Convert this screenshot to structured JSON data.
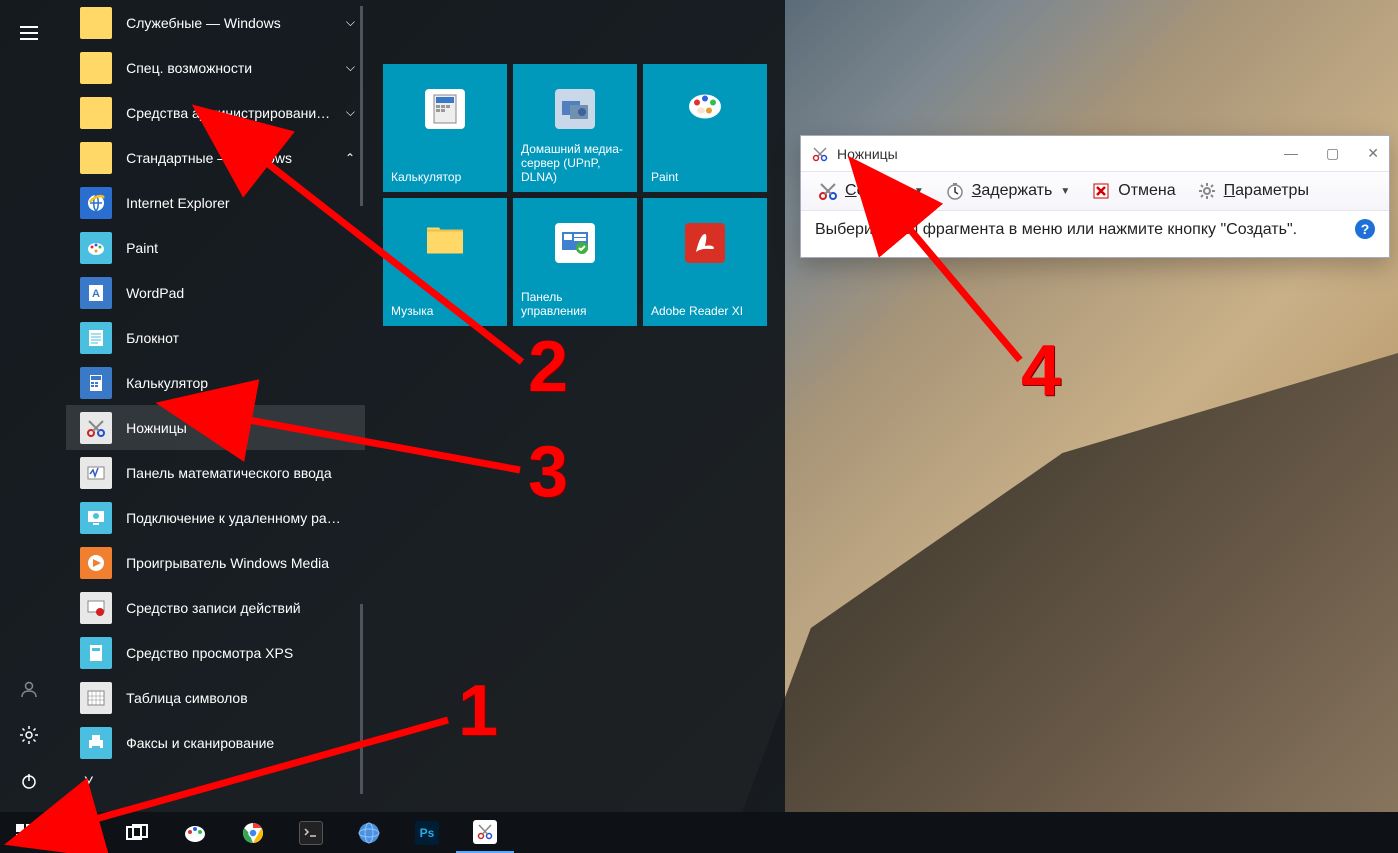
{
  "start_menu": {
    "folders": [
      {
        "label": "Служебные — Windows",
        "expanded": false
      },
      {
        "label": "Спец. возможности",
        "expanded": false
      },
      {
        "label": "Средства администрировани…",
        "expanded": false
      },
      {
        "label": "Стандартные — Windows",
        "expanded": true
      }
    ],
    "apps": [
      {
        "label": "Internet Explorer",
        "icon": "ie",
        "color": "#2a6fcf"
      },
      {
        "label": "Paint",
        "icon": "paint",
        "color": "#4abfe0"
      },
      {
        "label": "WordPad",
        "icon": "wordpad",
        "color": "#3a78c8"
      },
      {
        "label": "Блокнот",
        "icon": "notepad",
        "color": "#4abfe0"
      },
      {
        "label": "Калькулятор",
        "icon": "calc",
        "color": "#3a78c8"
      },
      {
        "label": "Ножницы",
        "icon": "snip",
        "color": "#e8e8e8",
        "highlight": true
      },
      {
        "label": "Панель математического ввода",
        "icon": "math",
        "color": "#e8e8e8"
      },
      {
        "label": "Подключение к удаленному ра…",
        "icon": "rdp",
        "color": "#4abfe0"
      },
      {
        "label": "Проигрыватель Windows Media",
        "icon": "wmp",
        "color": "#f08030"
      },
      {
        "label": "Средство записи действий",
        "icon": "steps",
        "color": "#e8e8e8"
      },
      {
        "label": "Средство просмотра XPS",
        "icon": "xps",
        "color": "#4abfe0"
      },
      {
        "label": "Таблица символов",
        "icon": "charmap",
        "color": "#e8e8e8"
      },
      {
        "label": "Факсы и сканирование",
        "icon": "fax",
        "color": "#4abfe0"
      }
    ],
    "letter_heading": "У",
    "tiles": [
      {
        "label": "Калькулятор",
        "icon": "calc"
      },
      {
        "label": "Домашний медиа-сервер (UPnP, DLNA)",
        "icon": "media"
      },
      {
        "label": "Paint",
        "icon": "paint"
      },
      {
        "label": "Музыка",
        "icon": "music"
      },
      {
        "label": "Панель управления",
        "icon": "control"
      },
      {
        "label": "Adobe Reader XI",
        "icon": "adobe"
      }
    ]
  },
  "snipping_tool": {
    "title": "Ножницы",
    "create": "Создать",
    "delay": "Задержать",
    "cancel": "Отмена",
    "options": "Параметры",
    "hint": "Выберите тип фрагмента в меню или нажмите кнопку \"Создать\"."
  },
  "annotations": {
    "1": "1",
    "2": "2",
    "3": "3",
    "4": "4"
  }
}
